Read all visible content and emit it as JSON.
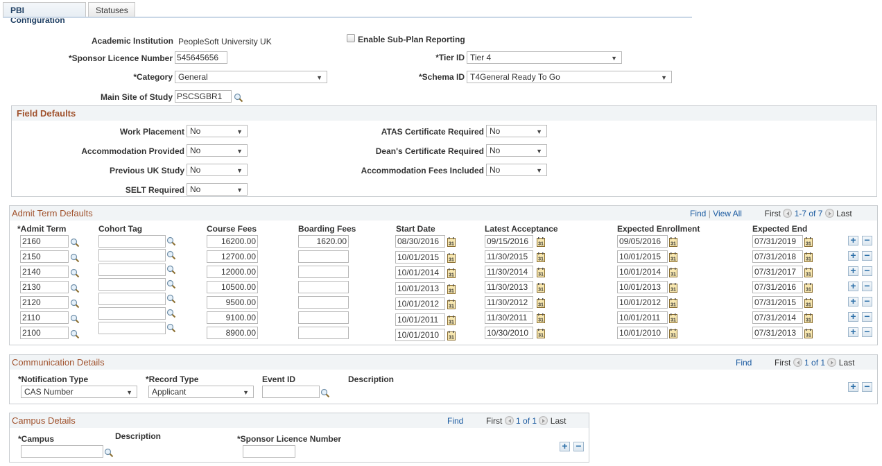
{
  "tabs": [
    {
      "label": "PBI Configuration",
      "active": true
    },
    {
      "label": "Statuses",
      "active": false
    }
  ],
  "header": {
    "academic_institution_label": "Academic Institution",
    "academic_institution_value": "PeopleSoft University UK",
    "sponsor_licence_label": "*Sponsor Licence Number",
    "sponsor_licence_value": "545645656",
    "category_label": "*Category",
    "category_value": "General",
    "main_site_label": "Main Site of Study",
    "main_site_value": "PSCSGBR1",
    "enable_subplan_label": "Enable Sub-Plan Reporting",
    "enable_subplan_checked": false,
    "tier_id_label": "*Tier ID",
    "tier_id_value": "Tier 4",
    "schema_id_label": "*Schema ID",
    "schema_id_value": "T4General Ready To Go"
  },
  "field_defaults": {
    "title": "Field Defaults",
    "left": [
      {
        "label": "Work Placement",
        "value": "No"
      },
      {
        "label": "Accommodation Provided",
        "value": "No"
      },
      {
        "label": "Previous UK Study",
        "value": "No"
      },
      {
        "label": "SELT Required",
        "value": "No"
      }
    ],
    "right": [
      {
        "label": "ATAS Certificate Required",
        "value": "No"
      },
      {
        "label": "Dean's Certificate Required",
        "value": "No"
      },
      {
        "label": "Accommodation Fees Included",
        "value": "No"
      }
    ]
  },
  "admit_term": {
    "title": "Admit Term Defaults",
    "find": "Find",
    "sep": "|",
    "view_all": "View All",
    "first": "First",
    "range": "1-7 of 7",
    "last": "Last",
    "columns": [
      "*Admit Term",
      "Cohort Tag",
      "Course Fees",
      "Boarding Fees",
      "Start Date",
      "Latest Acceptance",
      "Expected Enrollment",
      "Expected End"
    ],
    "rows": [
      {
        "term": "2160",
        "cohort": "",
        "course_fees": "16200.00",
        "boarding_fees": "1620.00",
        "start": "08/30/2016",
        "latest": "09/15/2016",
        "enroll": "09/05/2016",
        "end": "07/31/2019"
      },
      {
        "term": "2150",
        "cohort": "",
        "course_fees": "12700.00",
        "boarding_fees": "",
        "start": "10/01/2015",
        "latest": "11/30/2015",
        "enroll": "10/01/2015",
        "end": "07/31/2018"
      },
      {
        "term": "2140",
        "cohort": "",
        "course_fees": "12000.00",
        "boarding_fees": "",
        "start": "10/01/2014",
        "latest": "11/30/2014",
        "enroll": "10/01/2014",
        "end": "07/31/2017"
      },
      {
        "term": "2130",
        "cohort": "",
        "course_fees": "10500.00",
        "boarding_fees": "",
        "start": "10/01/2013",
        "latest": "11/30/2013",
        "enroll": "10/01/2013",
        "end": "07/31/2016"
      },
      {
        "term": "2120",
        "cohort": "",
        "course_fees": "9500.00",
        "boarding_fees": "",
        "start": "10/01/2012",
        "latest": "11/30/2012",
        "enroll": "10/01/2012",
        "end": "07/31/2015"
      },
      {
        "term": "2110",
        "cohort": "",
        "course_fees": "9100.00",
        "boarding_fees": "",
        "start": "10/01/2011",
        "latest": "11/30/2011",
        "enroll": "10/01/2011",
        "end": "07/31/2014"
      },
      {
        "term": "2100",
        "cohort": "",
        "course_fees": "8900.00",
        "boarding_fees": "",
        "start": "10/01/2010",
        "latest": "10/30/2010",
        "enroll": "10/01/2010",
        "end": "07/31/2013"
      }
    ]
  },
  "communication": {
    "title": "Communication Details",
    "find": "Find",
    "first": "First",
    "range": "1 of 1",
    "last": "Last",
    "notification_type_label": "*Notification Type",
    "notification_type_value": "CAS Number",
    "record_type_label": "*Record Type",
    "record_type_value": "Applicant",
    "event_id_label": "Event ID",
    "event_id_value": "",
    "description_label": "Description"
  },
  "campus": {
    "title": "Campus Details",
    "find": "Find",
    "first": "First",
    "range": "1 of 1",
    "last": "Last",
    "campus_label": "*Campus",
    "campus_value": "",
    "description_label": "Description",
    "sponsor_licence_label": "*Sponsor Licence Number",
    "sponsor_licence_value": ""
  },
  "icons": {
    "lookup": "magnifier",
    "calendar": "calendar-31",
    "add_row": "+",
    "delete_row": "−",
    "dropdown": "▼"
  }
}
